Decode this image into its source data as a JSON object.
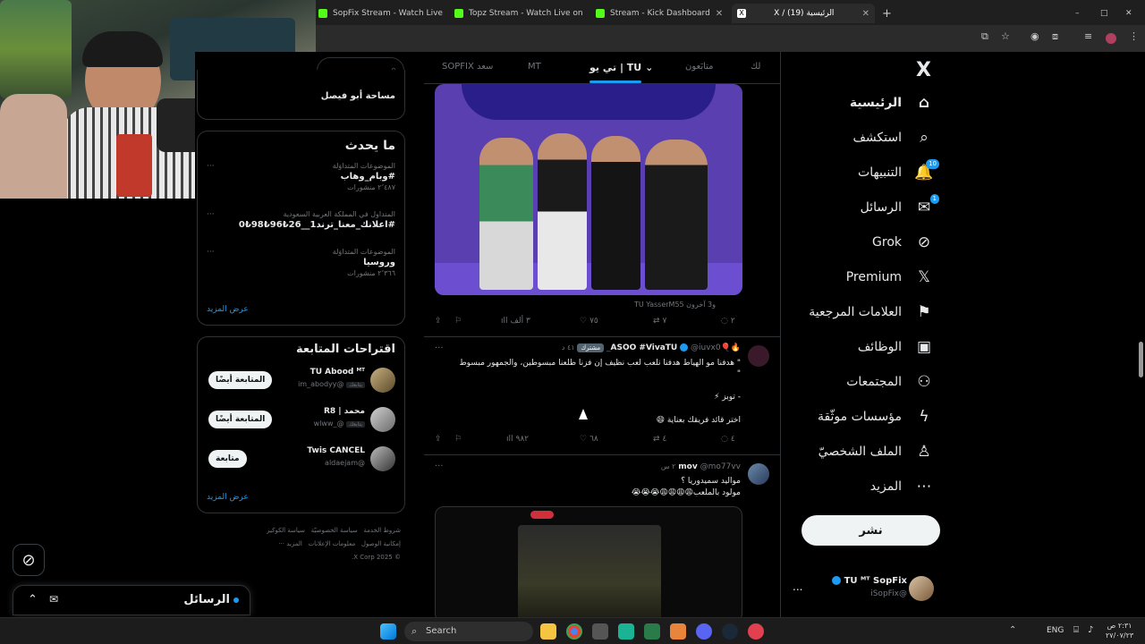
{
  "browser": {
    "tabs": [
      {
        "title": "SopFix Stream - Watch Live on",
        "favicon_color": "#53fc18"
      },
      {
        "title": "Topz Stream - Watch Live on K",
        "favicon_color": "#53fc18"
      },
      {
        "title": "Stream - Kick Dashboard",
        "favicon_color": "#53fc18"
      },
      {
        "title": "X / (19) الرئيسية",
        "favicon_color": "#ffffff"
      }
    ],
    "new_tab": "+",
    "window_controls": [
      "–",
      "□",
      "✕"
    ]
  },
  "nav": {
    "logo": "X",
    "items": [
      {
        "label": "الرئيسية",
        "icon": "home-icon",
        "glyph": "⌂",
        "badge": ""
      },
      {
        "label": "استكشف",
        "icon": "search-icon",
        "glyph": "⌕",
        "badge": ""
      },
      {
        "label": "التنبيهات",
        "icon": "bell-icon",
        "glyph": "🔔",
        "badge": "10"
      },
      {
        "label": "الرسائل",
        "icon": "mail-icon",
        "glyph": "✉",
        "badge": "1"
      },
      {
        "label": "Grok",
        "icon": "grok-icon",
        "glyph": "⊘",
        "badge": ""
      },
      {
        "label": "Premium",
        "icon": "x-premium-icon",
        "glyph": "𝕏",
        "badge": ""
      },
      {
        "label": "العلامات المرجعية",
        "icon": "bookmark-icon",
        "glyph": "⚑",
        "badge": ""
      },
      {
        "label": "الوظائف",
        "icon": "briefcase-icon",
        "glyph": "▣",
        "badge": ""
      },
      {
        "label": "المجتمعات",
        "icon": "people-icon",
        "glyph": "⚇",
        "badge": ""
      },
      {
        "label": "مؤسسات موثّقة",
        "icon": "lightning-icon",
        "glyph": "ϟ",
        "badge": ""
      },
      {
        "label": "الملف الشخصيّ",
        "icon": "profile-icon",
        "glyph": "♙",
        "badge": ""
      },
      {
        "label": "المزيد",
        "icon": "more-circle-icon",
        "glyph": "⋯",
        "badge": ""
      }
    ],
    "post_button": "نشر",
    "account": {
      "name": "TU ᴹᵀ SopFix",
      "handle": "@iSopFix",
      "more": "..."
    }
  },
  "feed": {
    "tabs": [
      "لك",
      "متابَعون",
      "تي يو | TU",
      "MT",
      "SOPFIX سعد"
    ],
    "post1": {
      "caption": "و3 آخرون TU YasserM55",
      "actions": {
        "reply": "٢",
        "retweet": "٧",
        "like": "٧٥",
        "views": "٣ ألف"
      }
    },
    "post2": {
      "name": "🔥🎈ASOO #VivaTU",
      "handle": "@iuvx0_",
      "sub_badge": "مشترك",
      "time": "٤١ د",
      "line1": "\" هدفنا مو الهياط هدفنا نلعب لعب نظيف إن فزنا طلعنا مبسوطين، والجمهور مبسوط",
      "line1b": "\"",
      "line2": "- توبز ⚡",
      "line3": "اختر قائد فريقك بعناية 😄",
      "actions": {
        "reply": "٤",
        "retweet": "٤",
        "like": "٦٨",
        "views": "٩٨٢"
      }
    },
    "post3": {
      "name": "mov",
      "handle": "@mo77vv",
      "time": "٢ س",
      "line1": "مواليد سميدوريا ؟",
      "line2": "مولود بالملعب😩😩😩😩😭😭😭"
    }
  },
  "sidebar": {
    "partial_top_line": "مساحة أبو فيصل",
    "trends_title": "ما يحدث",
    "trends": [
      {
        "context": "الموضوعات المتداوَلة",
        "name": "#وبام_وهاب",
        "count": "٢٬٤٨٧ منشورات"
      },
      {
        "context": "المتداول في المملكة العربية السعودية",
        "name": "#اعلانك_معنا_ترند1__26₺96₺98₺0",
        "count": ""
      },
      {
        "context": "الموضوعات المتداوَلة",
        "name": "وروسيا",
        "count": "٢٬٣٦٦ منشورات"
      }
    ],
    "show_more": "عرض المزيد",
    "who_to_follow_title": "اقتراحات المتابعة",
    "follows": [
      {
        "name": "TU Abood ᴹᵀ",
        "handle": "@im_abodyy",
        "button": "المتابعة أيضًا",
        "follows_you": "يتابعك"
      },
      {
        "name": "محمد | R8",
        "handle": "@_wlww",
        "button": "المتابعة أيضًا",
        "follows_you": "يتابعك"
      },
      {
        "name": "Twis CANCEL",
        "handle": "@aldaejam",
        "button": "متابعة",
        "follows_you": ""
      }
    ],
    "footer_links": [
      "شروط الخدمة",
      "سياسة الخصوصيّة",
      "سياسة الكوكيز",
      "إمكانية الوصول",
      "معلومات الإعلانات",
      "المزيد ···",
      "© 2025 X Corp."
    ]
  },
  "messages_dock": {
    "title": "الرسائل"
  },
  "taskbar": {
    "search_placeholder": "Search",
    "lang": "ENG",
    "time": "٢:٣١ ص",
    "date": "٢٧/٠٧/٢٣"
  },
  "colors": {
    "accent": "#1d9bf0",
    "bg": "#000000",
    "border": "#2f3336",
    "muted": "#71767b",
    "text": "#e7e9ea"
  }
}
